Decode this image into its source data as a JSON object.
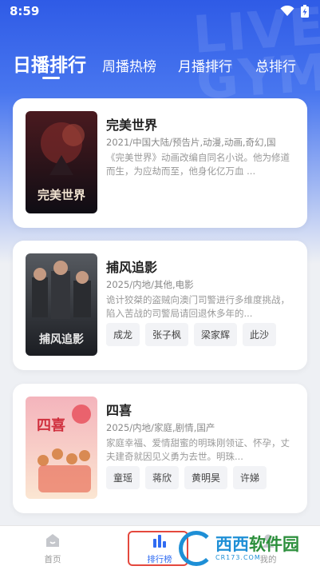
{
  "status_bar": {
    "time": "8:59"
  },
  "tabs": [
    {
      "label": "日播排行",
      "active": true
    },
    {
      "label": "周播热榜",
      "active": false
    },
    {
      "label": "月播排行",
      "active": false
    },
    {
      "label": "总排行",
      "active": false
    }
  ],
  "movies": [
    {
      "title": "完美世界",
      "meta": "2021/中国大陆/预告片,动漫,动画,奇幻,国",
      "description": "《完美世界》动画改编自同名小说。他为修道而生，为应劫而至，他身化亿万血 ...",
      "actors": [],
      "poster_text": "完美世界",
      "poster_colors": [
        "#4a1a1f",
        "#0f0d14"
      ]
    },
    {
      "title": "捕风追影",
      "meta": "2025/内地/其他,电影",
      "description": "诡计狡桀的盗贼向澳门司警进行多维度挑战，陷入苦战的司警局请回退休多年的...",
      "actors": [
        "成龙",
        "张子枫",
        "梁家辉",
        "此沙"
      ],
      "poster_text": "捕风追影",
      "poster_colors": [
        "#565a60",
        "#1b1d22"
      ]
    },
    {
      "title": "四喜",
      "meta": "2025/内地/家庭,剧情,国产",
      "description": "家庭幸福、爱情甜蜜的明珠刚领证、怀孕，丈夫建奇就因见义勇为去世。明珠...",
      "actors": [
        "童瑶",
        "蒋欣",
        "黄明昊",
        "许娣"
      ],
      "poster_text": "四喜",
      "poster_colors": [
        "#f4b4bc",
        "#fbe6d2"
      ]
    }
  ],
  "bottom_nav": [
    {
      "label": "首页",
      "icon": "home-icon",
      "active": false
    },
    {
      "label": "排行榜",
      "icon": "ranking-icon",
      "active": true
    },
    {
      "label": "我的",
      "icon": "profile-icon",
      "active": false
    }
  ],
  "watermark": {
    "main_a": "西西",
    "main_b": "软件园",
    "sub": "CR173.COM"
  },
  "colors": {
    "accent": "#2f6bf2",
    "hero": "#2f5be6",
    "highlight": "#e4483d"
  }
}
